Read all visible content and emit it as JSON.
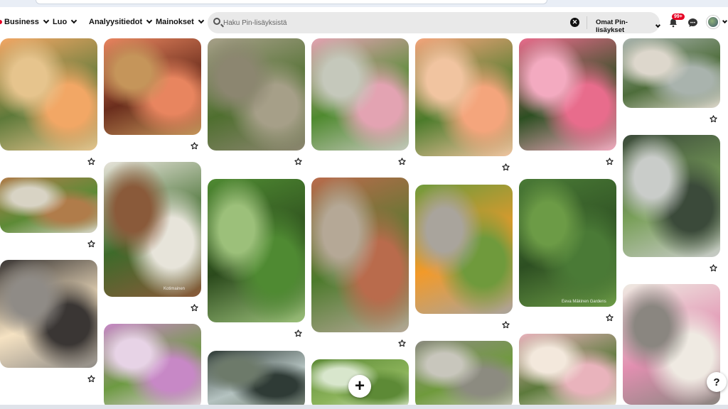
{
  "header": {
    "nav": [
      {
        "label": "Business"
      },
      {
        "label": "Luo"
      },
      {
        "label": "Analyysitiedot"
      },
      {
        "label": "Mainokset"
      }
    ],
    "search": {
      "placeholder": "Haku Pin-lisäyksistä",
      "clear_glyph": "✕",
      "scope_label": "Omat Pin-lisäykset"
    },
    "notification_badge": "99+"
  },
  "pins": [
    {
      "name": "pin-orange-echinacea-field",
      "colors": [
        "#f2a765",
        "#5e7a3a",
        "#e6c48d"
      ]
    },
    {
      "name": "pin-coneflowers-closeup",
      "colors": [
        "#e8855f",
        "#6b2e1d",
        "#c5955a"
      ]
    },
    {
      "name": "pin-stone-path-garden",
      "colors": [
        "#a69f88",
        "#4f6f2f",
        "#8c8670"
      ]
    },
    {
      "name": "pin-pink-peony-bed",
      "colors": [
        "#e3a3b2",
        "#4f8a2f",
        "#c5c8bb"
      ]
    },
    {
      "name": "pin-coral-peony",
      "colors": [
        "#f4a57c",
        "#4c7b2b",
        "#f1c4a0"
      ]
    },
    {
      "name": "pin-pink-peonies",
      "colors": [
        "#e86c8c",
        "#2d4f22",
        "#f3aac0"
      ]
    },
    {
      "name": "pin-greenhouse-beds",
      "colors": [
        "#a9b3ad",
        "#4e6d3b",
        "#ddd7cc"
      ]
    },
    {
      "name": "pin-raised-wooden-beds",
      "colors": [
        "#b07c4a",
        "#5d8a36",
        "#d8d3c4"
      ]
    },
    {
      "name": "pin-window-cold-frame",
      "colors": [
        "#e7e4da",
        "#3e6a2a",
        "#8a5a3a"
      ]
    },
    {
      "name": "pin-fern-border",
      "colors": [
        "#4f8a32",
        "#2b4a1c",
        "#9cc07a"
      ]
    },
    {
      "name": "pin-gravel-path-brick-wall",
      "colors": [
        "#b96b4c",
        "#4d7a2c",
        "#b5a896"
      ]
    },
    {
      "name": "pin-fire-pit-lawn",
      "colors": [
        "#6f9a3c",
        "#f29a2a",
        "#a9a49c"
      ]
    },
    {
      "name": "pin-conifer-garden",
      "colors": [
        "#4a7a36",
        "#2d4f22",
        "#6c9b46"
      ]
    },
    {
      "name": "pin-black-greenhouse",
      "colors": [
        "#3b4a3a",
        "#7aa05a",
        "#c9ccc9"
      ]
    },
    {
      "name": "pin-string-lights-patio",
      "colors": [
        "#3a3634",
        "#f5e2c2",
        "#8f8b86"
      ]
    },
    {
      "name": "pin-wildflower-meadow",
      "colors": [
        "#c788c6",
        "#6d9a42",
        "#e7d3e6"
      ]
    },
    {
      "name": "pin-modern-house-garden",
      "colors": [
        "#2f3b36",
        "#b4c2c0",
        "#6d7a6a"
      ]
    },
    {
      "name": "pin-garden-arch-trees",
      "colors": [
        "#5d8a36",
        "#8bb35a",
        "#d8e6cc"
      ]
    },
    {
      "name": "pin-stepping-stones",
      "colors": [
        "#8c8b80",
        "#6f9a3c",
        "#c8c6bc"
      ]
    },
    {
      "name": "pin-rose-arbor",
      "colors": [
        "#e9b3bc",
        "#5d7a3c",
        "#f3e8dc"
      ]
    },
    {
      "name": "pin-white-pergola-roses",
      "colors": [
        "#efeae2",
        "#e18fb0",
        "#8a8680"
      ]
    }
  ],
  "watermarks": {
    "cold_frame": "Kotimainen",
    "conifer": "Eeva Mäkinen Gardens"
  },
  "fab": {
    "plus": "+",
    "help": "?"
  }
}
